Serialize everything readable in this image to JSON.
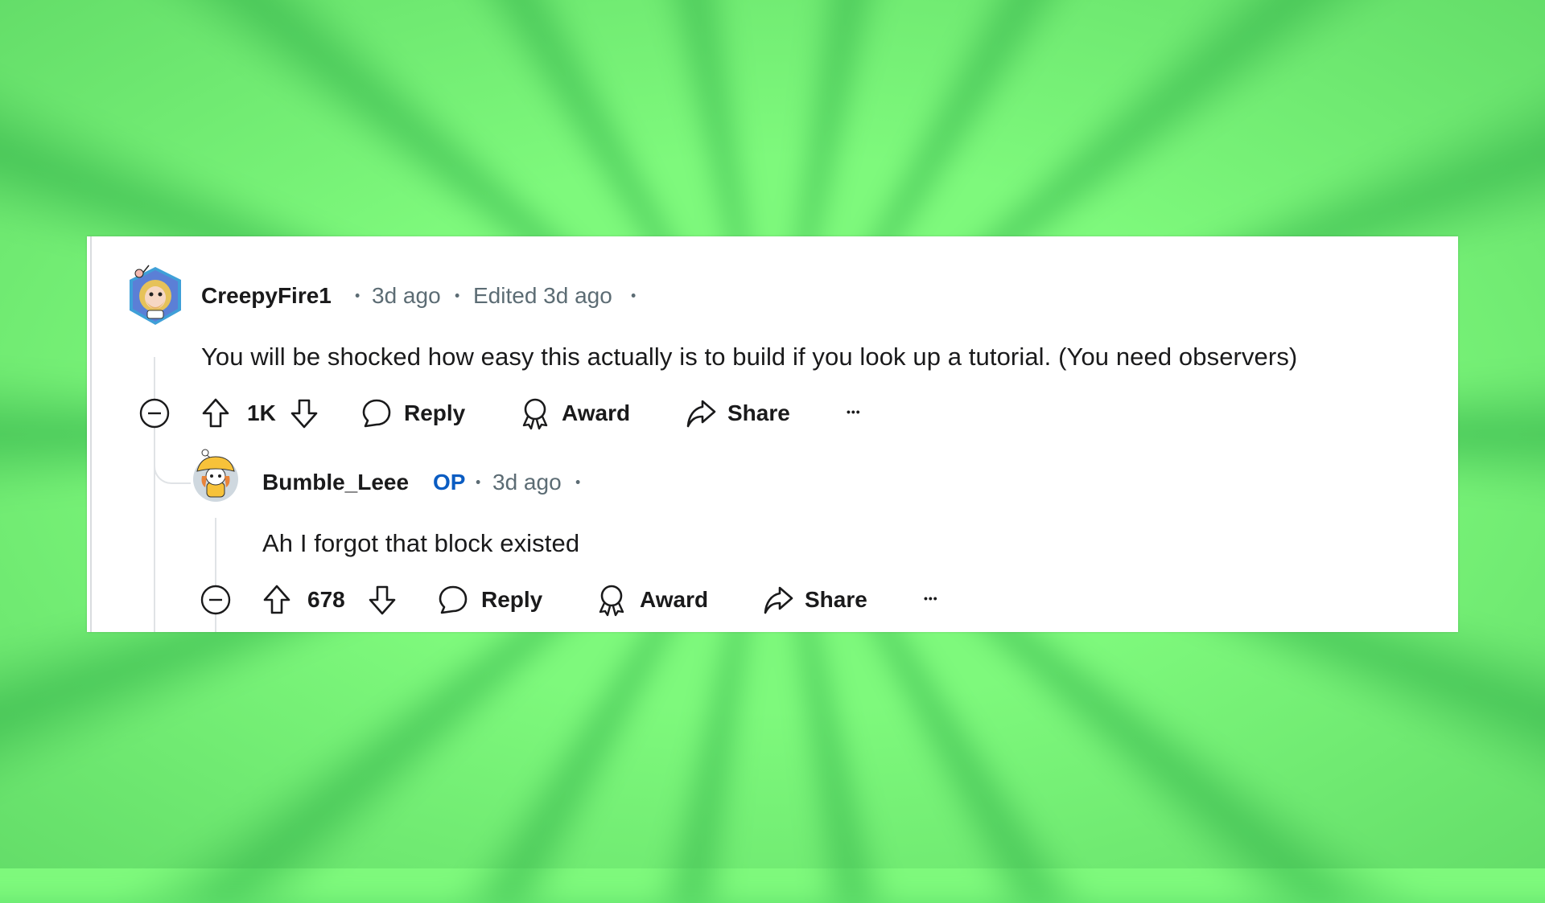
{
  "comments": [
    {
      "username": "CreepyFire1",
      "meta_sep1": "•",
      "posted": "3d ago",
      "meta_sep2": "•",
      "edited": "Edited 3d ago",
      "meta_sep3": "•",
      "body": "You will be shocked how easy this actually is to build if you look up a tutorial. (You need observers)",
      "score": "1K",
      "actions": {
        "reply": "Reply",
        "award": "Award",
        "share": "Share",
        "more": "•••"
      },
      "avatar_colors": {
        "frame": "#3fa0d8",
        "hair": "#e6c25a",
        "skin": "#f6d7c3"
      }
    },
    {
      "username": "Bumble_Leee",
      "op_badge": "OP",
      "meta_sep1": "•",
      "posted": "3d ago",
      "meta_sep2": "•",
      "body": "Ah I forgot that block existed",
      "score": "678",
      "actions": {
        "reply": "Reply",
        "award": "Award",
        "share": "Share",
        "more": "•••"
      },
      "avatar_colors": {
        "hat": "#f7c23a",
        "hair": "#e8833a",
        "bg": "#cfd8df"
      }
    }
  ],
  "colors": {
    "text": "#1a1a1b",
    "meta": "#5c6c74",
    "op": "#0a5cc2",
    "background_light": "#7ef97c",
    "background_dark": "#3fb44e"
  }
}
